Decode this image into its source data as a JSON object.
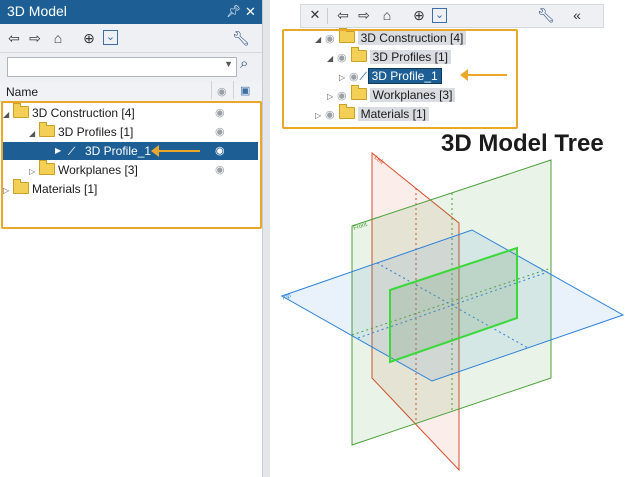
{
  "left": {
    "title": "3D Model",
    "column_header": "Name",
    "search_value": "",
    "tree": [
      {
        "label": "3D Construction [4]",
        "expanded": true
      },
      {
        "label": "3D Profiles [1]",
        "expanded": true
      },
      {
        "label": "3D Profile_1",
        "selected": true
      },
      {
        "label": "Workplanes [3]",
        "expanded": false
      },
      {
        "label": "Materials [1]",
        "expanded": false
      }
    ]
  },
  "right": {
    "caption": "3D Model Tree",
    "tree": [
      {
        "label": "3D Construction [4]"
      },
      {
        "label": "3D Profiles [1]"
      },
      {
        "label": "3D Profile_1"
      },
      {
        "label": "Workplanes [3]"
      },
      {
        "label": "Materials [1]"
      }
    ],
    "plane_labels": {
      "left": "Left",
      "front": "Front",
      "top": "Top"
    }
  },
  "icons": {
    "close": "close-icon",
    "back": "arrow-left-icon",
    "forward": "arrow-right-icon",
    "home": "home-icon",
    "crosshair": "crosshair-icon",
    "expand": "expand-icon",
    "wrench": "wrench-icon",
    "collapse": "collapse-icon",
    "search": "search-icon",
    "eye": "eye-icon",
    "box": "box-icon",
    "pin": "pin-icon"
  },
  "colors": {
    "title_bar": "#1d5f95",
    "highlight": "#eaa72a",
    "plane_left": "#d94b2a",
    "plane_front": "#4aa03a",
    "plane_top": "#2a7fd9",
    "profile": "#39d939"
  }
}
